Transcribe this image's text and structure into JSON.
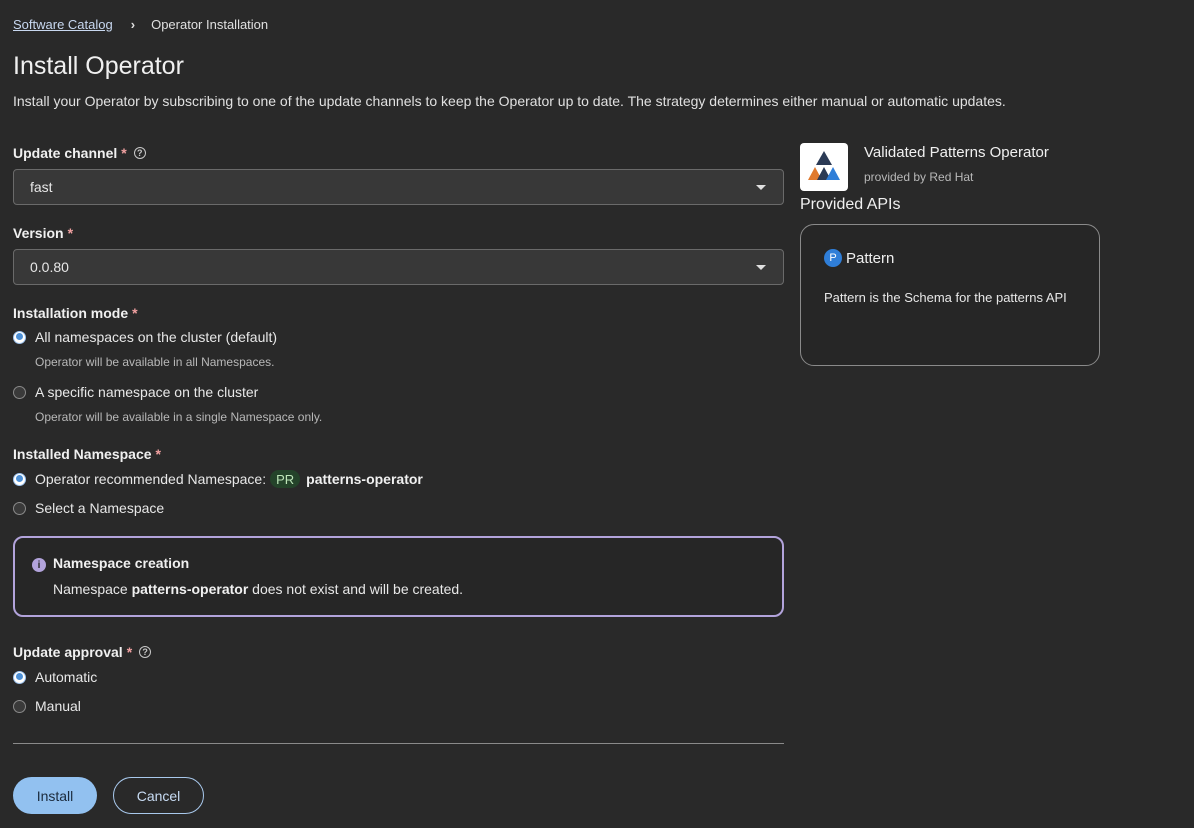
{
  "breadcrumb": {
    "parent": "Software Catalog",
    "current": "Operator Installation"
  },
  "page": {
    "title": "Install Operator",
    "description": "Install your Operator by subscribing to one of the update channels to keep the Operator up to date. The strategy determines either manual or automatic updates."
  },
  "form": {
    "update_channel": {
      "label": "Update channel",
      "required_mark": "*",
      "value": "fast"
    },
    "version": {
      "label": "Version",
      "required_mark": "*",
      "value": "0.0.80"
    },
    "installation_mode": {
      "label": "Installation mode",
      "required_mark": "*",
      "options": [
        {
          "label": "All namespaces on the cluster (default)",
          "help": "Operator will be available in all Namespaces.",
          "checked": true
        },
        {
          "label": "A specific namespace on the cluster",
          "help": "Operator will be available in a single Namespace only.",
          "checked": false
        }
      ]
    },
    "installed_namespace": {
      "label": "Installed Namespace",
      "required_mark": "*",
      "recommended_label": "Operator recommended Namespace:",
      "badge": "PR",
      "namespace": "patterns-operator",
      "select_label": "Select a Namespace"
    },
    "alert": {
      "title": "Namespace creation",
      "body_prefix": "Namespace",
      "body_namespace": "patterns-operator",
      "body_suffix": "does not exist and will be created."
    },
    "update_approval": {
      "label": "Update approval",
      "required_mark": "*",
      "options": [
        {
          "label": "Automatic",
          "checked": true
        },
        {
          "label": "Manual",
          "checked": false
        }
      ]
    },
    "buttons": {
      "install": "Install",
      "cancel": "Cancel"
    }
  },
  "operator": {
    "name": "Validated Patterns Operator",
    "provider": "provided by Red Hat",
    "provided_apis_title": "Provided APIs",
    "api": {
      "badge": "P",
      "name": "Pattern",
      "description": "Pattern is the Schema for the patterns API"
    }
  },
  "colors": {
    "background": "#292929",
    "accent": "#92c1f0",
    "alert_border": "#b2a3db",
    "required": "#f0a0a0"
  }
}
